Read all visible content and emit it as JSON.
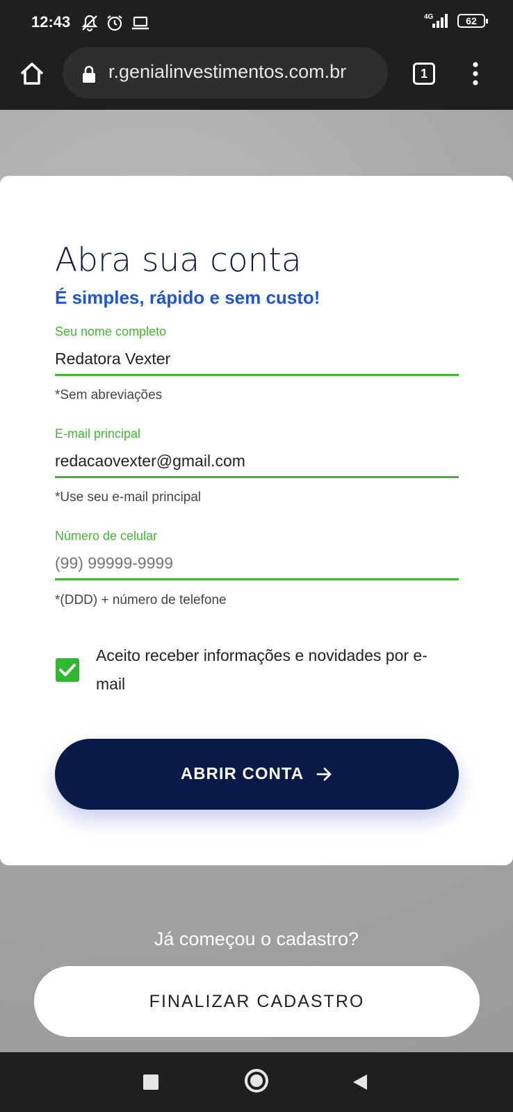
{
  "status_bar": {
    "time": "12:43",
    "network": "4G",
    "battery": "62",
    "icons": [
      "mute-icon",
      "alarm-icon",
      "laptop-icon",
      "signal-icon",
      "battery-icon"
    ]
  },
  "browser": {
    "url": "r.genialinvestimentos.com.br",
    "tab_count": "1"
  },
  "form": {
    "title": "Abra sua conta",
    "subtitle": "É simples, rápido e sem custo!",
    "name": {
      "label": "Seu nome completo",
      "value": "Redatora Vexter",
      "hint": "*Sem abreviações"
    },
    "email": {
      "label": "E-mail principal",
      "value": "redacaovexter@gmail.com",
      "hint": "*Use seu e-mail principal"
    },
    "phone": {
      "label": "Número de celular",
      "placeholder": "(99) 99999-9999",
      "hint": "*(DDD) + número de telefone"
    },
    "consent": {
      "label": "Aceito receber informações e novidades por e-mail",
      "checked": true
    },
    "submit_label": "ABRIR CONTA"
  },
  "footer": {
    "already_text": "Já começou o cadastro?",
    "finish_label": "FINALIZAR CADASTRO"
  },
  "colors": {
    "accent_green": "#3fba2f",
    "brand_blue": "#1d55d8",
    "button_navy": "#081a47"
  }
}
